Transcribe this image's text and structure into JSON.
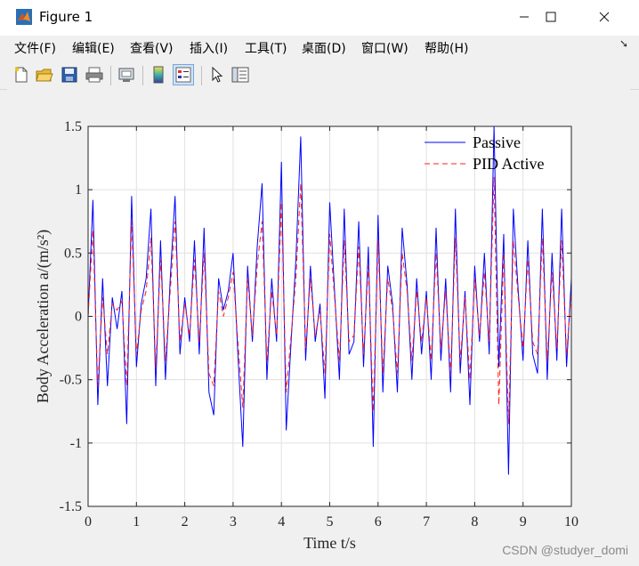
{
  "window": {
    "title": "Figure 1"
  },
  "menu": [
    {
      "label": "文件(F)"
    },
    {
      "label": "编辑(E)"
    },
    {
      "label": "查看(V)"
    },
    {
      "label": "插入(I)"
    },
    {
      "label": "工具(T)"
    },
    {
      "label": "桌面(D)"
    },
    {
      "label": "窗口(W)"
    },
    {
      "label": "帮助(H)"
    }
  ],
  "toolbar": [
    "new-figure-icon",
    "open-file-icon",
    "save-icon",
    "print-icon",
    "print-preview-icon",
    "colorbar-icon",
    "legend-icon",
    "edit-plot-icon",
    "property-inspector-icon"
  ],
  "watermark": "CSDN @studyer_domi",
  "chart_data": {
    "type": "line",
    "xlabel": "Time t/s",
    "ylabel": "Body Acceleration a/(m/s²)",
    "xlim": [
      0,
      10
    ],
    "ylim": [
      -1.5,
      1.5
    ],
    "grid": true,
    "legend_position": "top-right",
    "xticks": [
      "0",
      "1",
      "2",
      "3",
      "4",
      "5",
      "6",
      "7",
      "8",
      "9",
      "10"
    ],
    "yticks": [
      "1.5",
      "1",
      "0.5",
      "0",
      "-0.5",
      "-1",
      "-1.5"
    ],
    "x": [
      0,
      0.1,
      0.2,
      0.3,
      0.4,
      0.5,
      0.6,
      0.7,
      0.8,
      0.9,
      1.0,
      1.1,
      1.2,
      1.3,
      1.4,
      1.5,
      1.6,
      1.7,
      1.8,
      1.9,
      2.0,
      2.1,
      2.2,
      2.3,
      2.4,
      2.5,
      2.6,
      2.7,
      2.8,
      2.9,
      3.0,
      3.1,
      3.2,
      3.3,
      3.4,
      3.5,
      3.6,
      3.7,
      3.8,
      3.9,
      4.0,
      4.1,
      4.2,
      4.3,
      4.4,
      4.5,
      4.6,
      4.7,
      4.8,
      4.9,
      5.0,
      5.1,
      5.2,
      5.3,
      5.4,
      5.5,
      5.6,
      5.7,
      5.8,
      5.9,
      6.0,
      6.1,
      6.2,
      6.3,
      6.4,
      6.5,
      6.6,
      6.7,
      6.8,
      6.9,
      7.0,
      7.1,
      7.2,
      7.3,
      7.4,
      7.5,
      7.6,
      7.7,
      7.8,
      7.9,
      8.0,
      8.1,
      8.2,
      8.3,
      8.4,
      8.5,
      8.6,
      8.7,
      8.8,
      8.9,
      9.0,
      9.1,
      9.2,
      9.3,
      9.4,
      9.5,
      9.6,
      9.7,
      9.8,
      9.9,
      10.0
    ],
    "series": [
      {
        "name": "Passive",
        "color": "#0000ff",
        "dash": "none",
        "values": [
          0,
          0.92,
          -0.7,
          0.3,
          -0.55,
          0.15,
          -0.1,
          0.2,
          -0.85,
          0.95,
          -0.4,
          0.1,
          0.3,
          0.85,
          -0.55,
          0.6,
          -0.5,
          0.3,
          0.95,
          -0.3,
          0.15,
          -0.2,
          0.6,
          -0.3,
          0.7,
          -0.6,
          -0.78,
          0.3,
          0.05,
          0.2,
          0.5,
          -0.3,
          -1.03,
          0.4,
          -0.2,
          0.55,
          1.05,
          -0.5,
          0.3,
          -0.2,
          1.22,
          -0.9,
          -0.2,
          0.45,
          1.42,
          -0.35,
          0.4,
          -0.2,
          0.1,
          -0.65,
          0.9,
          0.2,
          -0.5,
          0.85,
          -0.3,
          -0.2,
          0.75,
          -0.4,
          0.55,
          -1.03,
          0.8,
          -0.6,
          0.4,
          0.1,
          -0.6,
          0.7,
          0.25,
          -0.5,
          0.3,
          -0.3,
          0.2,
          -0.5,
          0.7,
          -0.35,
          0.3,
          -0.6,
          0.85,
          -0.45,
          0.2,
          -0.7,
          0.4,
          -0.2,
          0.5,
          -0.3,
          1.5,
          -0.4,
          0.65,
          -1.25,
          0.85,
          0.2,
          -0.35,
          0.6,
          -0.3,
          -0.45,
          0.85,
          -0.5,
          0.5,
          -0.35,
          0.85,
          -0.4,
          0.3
        ]
      },
      {
        "name": "PID Active",
        "color": "#ff2020",
        "dash": "6,4",
        "values": [
          0,
          0.68,
          -0.55,
          0.15,
          -0.3,
          0.1,
          0.05,
          0.12,
          -0.55,
          0.75,
          -0.3,
          0.05,
          0.2,
          0.62,
          -0.4,
          0.45,
          -0.35,
          0.2,
          0.75,
          -0.2,
          0.1,
          -0.15,
          0.45,
          -0.2,
          0.5,
          -0.45,
          -0.55,
          0.2,
          0.0,
          0.15,
          0.35,
          -0.2,
          -0.72,
          0.3,
          -0.15,
          0.4,
          0.75,
          -0.35,
          0.2,
          -0.15,
          0.9,
          -0.6,
          -0.15,
          0.3,
          1.05,
          -0.25,
          0.3,
          -0.15,
          0.05,
          -0.45,
          0.65,
          0.15,
          -0.35,
          0.6,
          -0.2,
          -0.15,
          0.55,
          -0.3,
          0.4,
          -0.75,
          0.6,
          -0.45,
          0.3,
          0.05,
          -0.45,
          0.5,
          0.2,
          -0.35,
          0.2,
          -0.2,
          0.15,
          -0.35,
          0.5,
          -0.25,
          0.2,
          -0.45,
          0.62,
          -0.35,
          0.15,
          -0.5,
          0.3,
          -0.15,
          0.35,
          -0.2,
          1.1,
          -0.7,
          0.5,
          -0.85,
          0.6,
          0.15,
          -0.25,
          0.45,
          -0.2,
          -0.3,
          0.62,
          -0.35,
          0.35,
          -0.25,
          0.6,
          -0.3,
          0.2
        ]
      }
    ]
  }
}
